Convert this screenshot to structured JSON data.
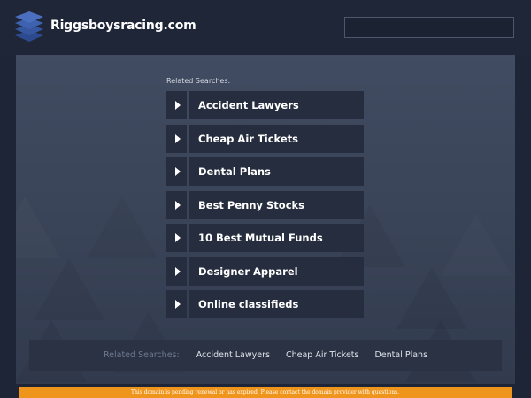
{
  "header": {
    "site_title": "Riggsboysracing.com",
    "logo_icon": "stacked-layers-icon",
    "search_placeholder": ""
  },
  "main": {
    "related_title": "Related Searches:",
    "links": [
      {
        "label": "Accident Lawyers"
      },
      {
        "label": "Cheap Air Tickets"
      },
      {
        "label": "Dental Plans"
      },
      {
        "label": "Best Penny Stocks"
      },
      {
        "label": "10 Best Mutual Funds"
      },
      {
        "label": "Designer Apparel"
      },
      {
        "label": "Online classifieds"
      }
    ]
  },
  "footer": {
    "title": "Related Searches:",
    "links": [
      "Accident Lawyers",
      "Cheap Air Tickets",
      "Dental Plans"
    ]
  },
  "notice": {
    "text": "This domain is pending renewal or has expired. Please contact the domain provider with questions."
  },
  "colors": {
    "background": "#1e2536",
    "panel": "#3b4559",
    "link_box": "#262d3e",
    "notice": "#f0951c",
    "logo": "#3d5eab"
  }
}
